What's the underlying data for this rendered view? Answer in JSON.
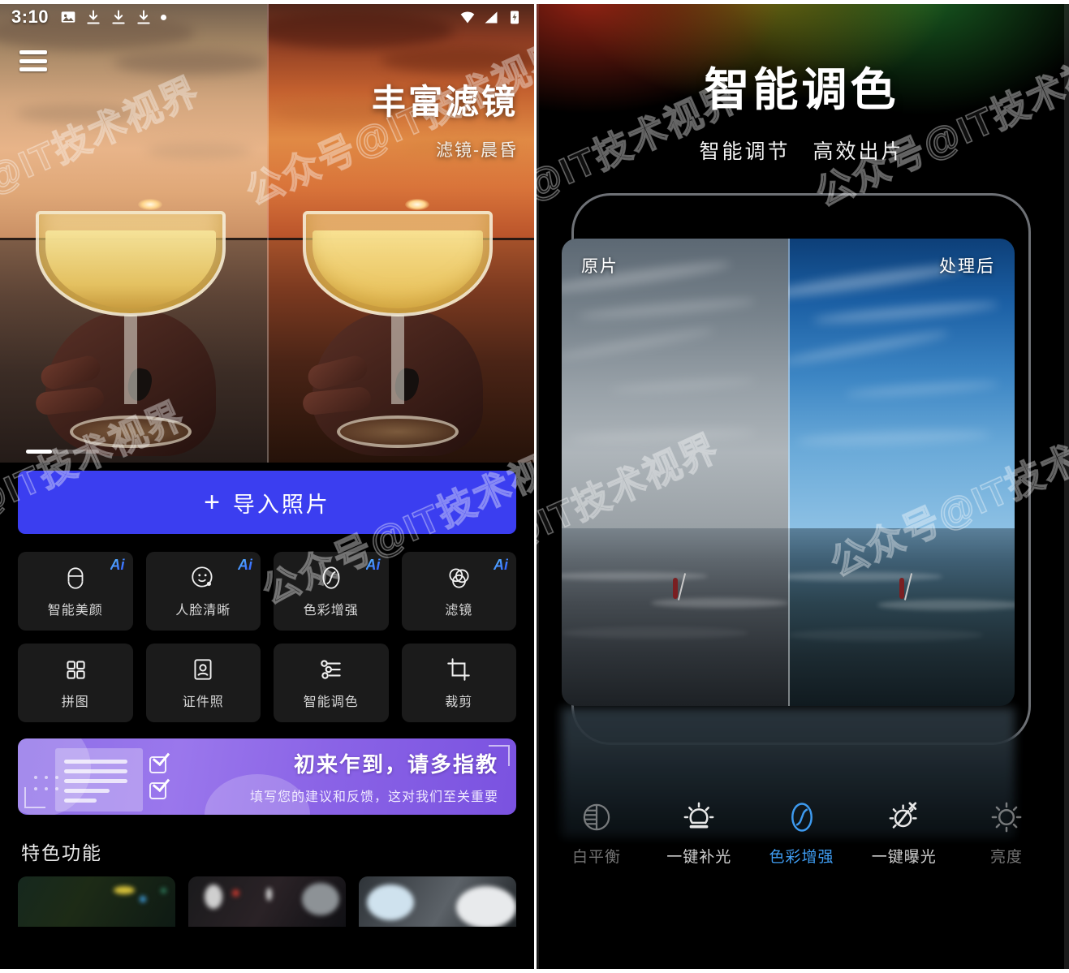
{
  "left_panel": {
    "status_bar": {
      "time": "3:10",
      "icons": [
        "image-icon",
        "download-icon",
        "download-icon",
        "download-icon",
        "dot-icon"
      ],
      "right_icons": [
        "wifi-icon",
        "signal-icon",
        "battery-charging-icon"
      ]
    },
    "menu_icon": "hamburger-menu-icon",
    "hero": {
      "title": "丰富滤镜",
      "subtitle": "滤镜-晨昏"
    },
    "import_button": {
      "plus": "+",
      "label": "导入照片",
      "color": "#3b3ef0"
    },
    "feature_grid": [
      {
        "label": "智能美颜",
        "badge": "Ai",
        "icon": "beauty-face-icon"
      },
      {
        "label": "人脸清晰",
        "badge": "Ai",
        "icon": "smiley-face-icon"
      },
      {
        "label": "色彩增强",
        "badge": "Ai",
        "icon": "color-enhance-icon"
      },
      {
        "label": "滤镜",
        "badge": "Ai",
        "icon": "filter-rings-icon"
      },
      {
        "label": "拼图",
        "badge": "",
        "icon": "collage-grid-icon"
      },
      {
        "label": "证件照",
        "badge": "",
        "icon": "id-photo-icon"
      },
      {
        "label": "智能调色",
        "badge": "",
        "icon": "sliders-icon"
      },
      {
        "label": "裁剪",
        "badge": "",
        "icon": "crop-icon"
      }
    ],
    "promo_banner": {
      "title": "初来乍到，请多指教",
      "subtitle": "填写您的建议和反馈，这对我们至关重要",
      "accent": "#8d6ee8"
    },
    "section_title": "特色功能"
  },
  "right_panel": {
    "title": "智能调色",
    "subtitle": "智能调节　高效出片",
    "compare": {
      "before_label": "原片",
      "after_label": "处理后"
    },
    "toolbar": [
      {
        "label": "白平衡",
        "icon": "white-balance-icon",
        "active": false
      },
      {
        "label": "一键补光",
        "icon": "fill-light-icon",
        "active": false
      },
      {
        "label": "色彩增强",
        "icon": "color-enhance-icon",
        "active": true
      },
      {
        "label": "一键曝光",
        "icon": "exposure-off-icon",
        "active": false
      },
      {
        "label": "亮度",
        "icon": "brightness-icon",
        "active": false
      }
    ],
    "accent_color": "#3e9bf0"
  },
  "watermark": {
    "text": "公众号@IT技术视界"
  }
}
